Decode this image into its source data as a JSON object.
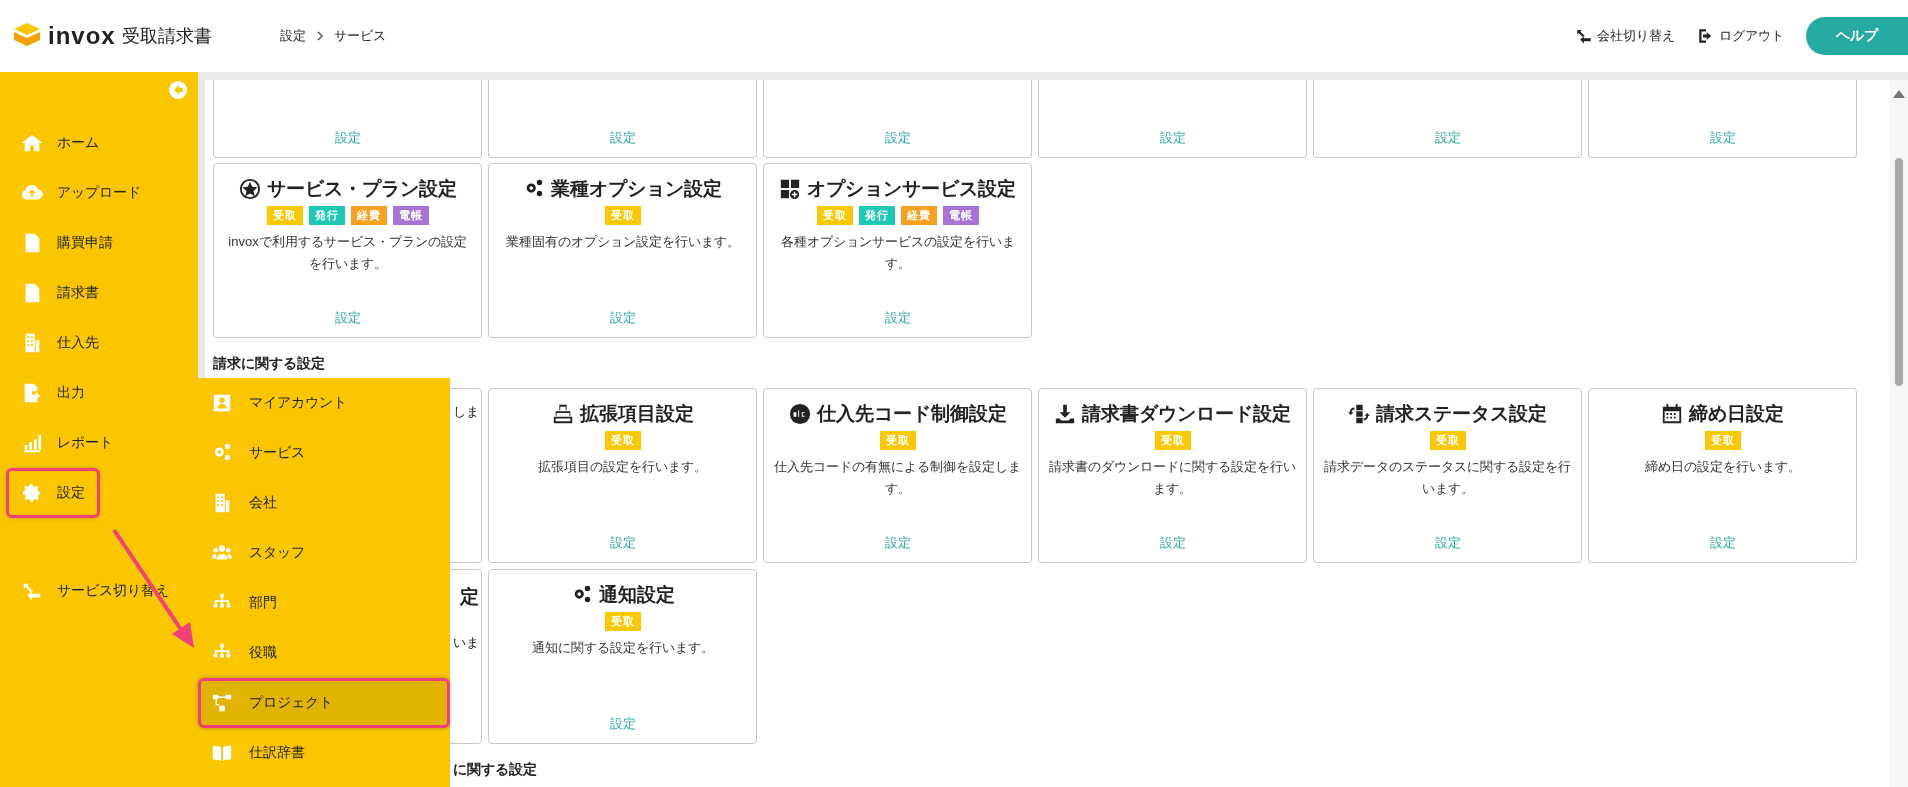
{
  "header": {
    "logo": {
      "brand": "invox",
      "product": "受取請求書"
    },
    "breadcrumb": [
      "設定",
      "サービス"
    ],
    "actions": [
      {
        "kind": "switch",
        "label": "会社切り替え"
      },
      {
        "kind": "logout",
        "label": "ログアウト"
      }
    ],
    "help_button": "ヘルプ"
  },
  "sidebar": {
    "items": [
      {
        "label": "ホーム",
        "highlighted": false
      },
      {
        "label": "アップロード",
        "highlighted": false
      },
      {
        "label": "購買申請",
        "highlighted": false
      },
      {
        "label": "請求書",
        "highlighted": false
      },
      {
        "label": "仕入先",
        "highlighted": false
      },
      {
        "label": "出力",
        "highlighted": false
      },
      {
        "label": "レポート",
        "highlighted": false
      },
      {
        "label": "設定",
        "highlighted": true
      }
    ],
    "bottom_items": [
      {
        "label": "サービス切り替え",
        "highlighted": false
      }
    ]
  },
  "submenu": {
    "items": [
      {
        "label": "マイアカウント",
        "selected": false
      },
      {
        "label": "サービス",
        "selected": false
      },
      {
        "label": "会社",
        "selected": false
      },
      {
        "label": "スタッフ",
        "selected": false
      },
      {
        "label": "部門",
        "selected": false
      },
      {
        "label": "役職",
        "selected": false
      },
      {
        "label": "プロジェクト",
        "selected": true
      },
      {
        "label": "仕訳辞書",
        "selected": false
      }
    ]
  },
  "sections": [
    {
      "cards": [
        {
          "kind": "cut",
          "link": "設定"
        },
        {
          "kind": "cut",
          "link": "設定"
        },
        {
          "kind": "cut",
          "link": "設定"
        },
        {
          "kind": "cut",
          "link": "設定"
        },
        {
          "kind": "cut",
          "link": "設定"
        },
        {
          "kind": "cut",
          "link": "設定"
        }
      ]
    },
    {
      "cards": [
        {
          "kind": "full",
          "title": "サービス・プラン設定",
          "badges": [
            {
              "label": "受取",
              "color": "#fac800"
            },
            {
              "label": "発行",
              "color": "#1dc9b5"
            },
            {
              "label": "経費",
              "color": "#f8a020"
            },
            {
              "label": "電帳",
              "color": "#a774d6"
            }
          ],
          "description": "invoxで利用するサービス・プランの設定を行います。",
          "link": "設定"
        },
        {
          "kind": "full",
          "title": "業種オプション設定",
          "badges": [
            {
              "label": "受取",
              "color": "#fac800"
            }
          ],
          "description": "業種固有のオプション設定を行います。",
          "link": "設定"
        },
        {
          "kind": "full",
          "title": "オプションサービス設定",
          "badges": [
            {
              "label": "受取",
              "color": "#fac800"
            },
            {
              "label": "発行",
              "color": "#1dc9b5"
            },
            {
              "label": "経費",
              "color": "#f8a020"
            },
            {
              "label": "電帳",
              "color": "#a774d6"
            }
          ],
          "description": "各種オプションサービスの設定を行います。",
          "link": "設定"
        }
      ]
    },
    {
      "title": "請求に関する設定",
      "cards": [
        {
          "kind": "covered",
          "description": "しま"
        },
        {
          "kind": "full",
          "title": "拡張項目設定",
          "badges": [
            {
              "label": "受取",
              "color": "#fac800"
            }
          ],
          "description": "拡張項目の設定を行います。",
          "link": "設定"
        },
        {
          "kind": "full",
          "title": "仕入先コード制御設定",
          "badges": [
            {
              "label": "受取",
              "color": "#fac800"
            }
          ],
          "description": "仕入先コードの有無による制御を設定します。",
          "link": "設定"
        },
        {
          "kind": "full",
          "title": "請求書ダウンロード設定",
          "badges": [
            {
              "label": "受取",
              "color": "#fac800"
            }
          ],
          "description": "請求書のダウンロードに関する設定を行います。",
          "link": "設定"
        },
        {
          "kind": "full",
          "title": "請求ステータス設定",
          "badges": [
            {
              "label": "受取",
              "color": "#fac800"
            }
          ],
          "description": "請求データのステータスに関する設定を行います。",
          "link": "設定"
        },
        {
          "kind": "full",
          "title": "締め日設定",
          "badges": [
            {
              "label": "受取",
              "color": "#fac800"
            }
          ],
          "description": "締め日の設定を行います。",
          "link": "設定"
        },
        {
          "kind": "covered",
          "title": "定",
          "description": "いま"
        },
        {
          "kind": "full",
          "title": "通知設定",
          "badges": [
            {
              "label": "受取",
              "color": "#fac800"
            }
          ],
          "description": "通知に関する設定を行います。",
          "link": "設定"
        }
      ]
    },
    {
      "title": "に関する設定",
      "covered": true
    }
  ]
}
